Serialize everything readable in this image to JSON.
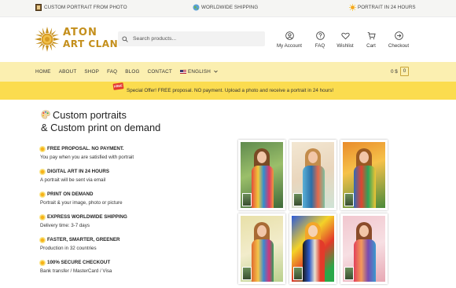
{
  "topbar": {
    "item1": "CUSTOM PORTRAIT FROM PHOTO",
    "item2": "WORLDWIDE SHIPPING",
    "item3": "PORTRAIT IN 24 HOURS"
  },
  "logo": {
    "line1": "ATON",
    "line2": "ART CLAN"
  },
  "search": {
    "placeholder": "Search products..."
  },
  "header_icons": {
    "account": "My Account",
    "faq": "FAQ",
    "wishlist": "Wishlist",
    "cart": "Cart",
    "checkout": "Checkout"
  },
  "nav": {
    "items": [
      "HOME",
      "ABOUT",
      "SHOP",
      "FAQ",
      "BLOG",
      "CONTACT"
    ],
    "language": "ENGLISH",
    "cart_total": "0 $",
    "cart_count": "0"
  },
  "offer": {
    "badge": "FREE",
    "text": "Special Offer!  FREE proposal. NO payment.  Upload a photo and receive a portrait in 24 hours!"
  },
  "hero": {
    "line1": "Custom portraits",
    "line2": "& Custom print on demand"
  },
  "features": [
    {
      "title": "FREE PROPOSAL. NO PAYMENT.",
      "desc": "You pay when you are satisfied with portrait"
    },
    {
      "title": "DIGITAL ART IN 24 HOURS",
      "desc": "A portrait will be sent via email"
    },
    {
      "title": "PRINT ON DEMAND",
      "desc": "Portrait & your image, photo or picture"
    },
    {
      "title": "EXPRESS WORLDWIDE SHIPPING",
      "desc": "Delivery time: 3-7 days"
    },
    {
      "title": "FASTER, SMARTER, GREENER",
      "desc": "Production in 32 countries"
    },
    {
      "title": "100% SECURE CHECKOUT",
      "desc": "Bank transfer / MasterCard / Visa"
    }
  ],
  "colors": {
    "nav_bg": "#fbefb0",
    "offer_bg": "#fbdc4f",
    "brand_gold": "#c48f1c"
  }
}
